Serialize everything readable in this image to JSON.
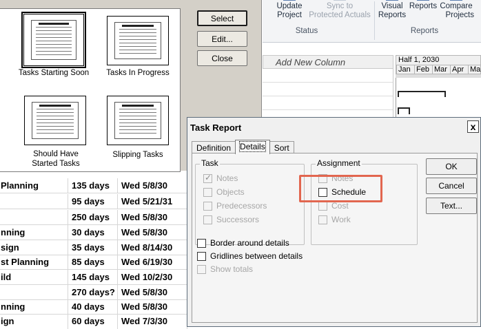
{
  "picker": {
    "tiles": [
      {
        "label": "Tasks Starting Soon",
        "selected": true
      },
      {
        "label": "Tasks In Progress",
        "selected": false
      },
      {
        "label": "Should Have Started Tasks",
        "selected": false
      },
      {
        "label": "Slipping Tasks",
        "selected": false
      }
    ],
    "buttons": {
      "select": "Select",
      "edit": "Edit...",
      "close": "Close"
    }
  },
  "ribbon": {
    "buttons": [
      {
        "label1": "Update",
        "label2": "Project",
        "enabled": true,
        "icon": "update-project-icon"
      },
      {
        "label1": "Sync to",
        "label2": "Protected Actuals",
        "enabled": false,
        "icon": "sync-icon"
      },
      {
        "label1": "Visual",
        "label2": "Reports",
        "enabled": true,
        "icon": "visual-reports-icon"
      },
      {
        "label1": "Reports",
        "label2": "",
        "enabled": true,
        "icon": "reports-icon"
      },
      {
        "label1": "Compare",
        "label2": "Projects",
        "enabled": true,
        "icon": "compare-projects-icon"
      }
    ],
    "groups": {
      "status": "Status",
      "reports": "Reports"
    }
  },
  "grid": {
    "add_column": "Add New Column",
    "timescale_top": "Half 1, 2030",
    "timescale_months": [
      "Jan",
      "Feb",
      "Mar",
      "Apr",
      "Ma"
    ]
  },
  "tasks": [
    {
      "name": "Planning",
      "duration": "135 days",
      "start": "Wed 5/8/30"
    },
    {
      "name": "",
      "duration": "95 days",
      "start": "Wed 5/21/31"
    },
    {
      "name": "",
      "duration": "250 days",
      "start": "Wed 5/8/30"
    },
    {
      "name": "nning",
      "duration": "30 days",
      "start": "Wed 5/8/30"
    },
    {
      "name": "sign",
      "duration": "35 days",
      "start": "Wed 8/14/30"
    },
    {
      "name": "st Planning",
      "duration": "85 days",
      "start": "Wed 6/19/30"
    },
    {
      "name": "ild",
      "duration": "145 days",
      "start": "Wed 10/2/30"
    },
    {
      "name": "",
      "duration": "270 days?",
      "start": "Wed 5/8/30"
    },
    {
      "name": "nning",
      "duration": "40 days",
      "start": "Wed 5/8/30"
    },
    {
      "name": "ign",
      "duration": "60 days",
      "start": "Wed 7/3/30"
    }
  ],
  "dialog": {
    "title": "Task Report",
    "close": "x",
    "tabs": [
      "Definition",
      "Details",
      "Sort"
    ],
    "active_tab": "Details",
    "task_group": {
      "legend": "Task",
      "items": [
        {
          "label": "Notes",
          "checked": true,
          "enabled": false
        },
        {
          "label": "Objects",
          "checked": false,
          "enabled": false
        },
        {
          "label": "Predecessors",
          "checked": false,
          "enabled": false
        },
        {
          "label": "Successors",
          "checked": false,
          "enabled": false
        }
      ]
    },
    "assignment_group": {
      "legend": "Assignment",
      "items": [
        {
          "label": "Notes",
          "checked": false,
          "enabled": false
        },
        {
          "label": "Schedule",
          "checked": false,
          "enabled": true
        },
        {
          "label": "Cost",
          "checked": false,
          "enabled": false
        },
        {
          "label": "Work",
          "checked": false,
          "enabled": false
        }
      ]
    },
    "options": [
      {
        "label": "Border around details",
        "checked": false,
        "enabled": true
      },
      {
        "label": "Gridlines between details",
        "checked": false,
        "enabled": true
      },
      {
        "label": "Show totals",
        "checked": false,
        "enabled": false
      }
    ],
    "buttons": {
      "ok": "OK",
      "cancel": "Cancel",
      "text": "Text..."
    },
    "highlight_color": "#e2664f"
  }
}
